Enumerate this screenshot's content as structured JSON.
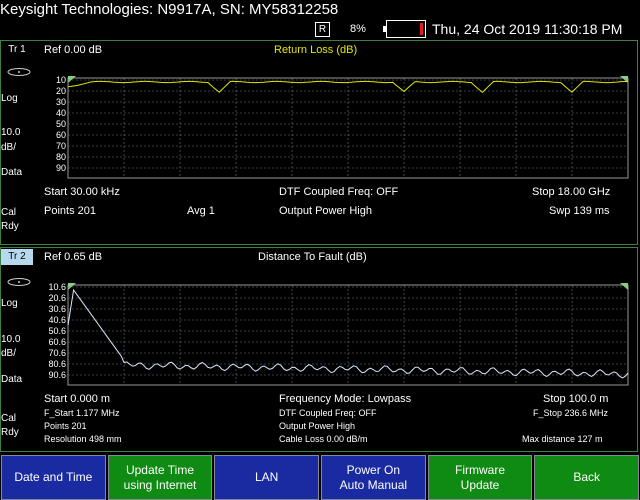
{
  "header": {
    "title": "Keysight Technologies: N9917A, SN: MY58312258",
    "r_indicator": "R",
    "battery_pct": "8%",
    "datetime": "Thu, 24 Oct 2019 11:30:18 PM"
  },
  "trace1": {
    "tab": "Tr 1",
    "ref": "Ref 0.00 dB",
    "name": "Return Loss (dB)",
    "scale_type": "Log",
    "scale_value": "10.0",
    "scale_unit": "dB/",
    "data_label": "Data",
    "cal_label": "Cal",
    "rdy_label": "Rdy",
    "y_ticks": [
      "10",
      "20",
      "30",
      "40",
      "50",
      "60",
      "70",
      "80",
      "90"
    ],
    "start": "Start 30.00 kHz",
    "center": "DTF Coupled Freq: OFF",
    "stop": "Stop 18.00 GHz",
    "points": "Points 201",
    "avg": "Avg  1",
    "output_power": "Output Power High",
    "sweep": "Swp 139 ms",
    "trace_color": "#e6e600"
  },
  "trace2": {
    "tab": "Tr 2",
    "ref": "Ref 0.65 dB",
    "name": "Distance To Fault (dB)",
    "scale_type": "Log",
    "scale_value": "10.0",
    "scale_unit": "dB/",
    "data_label": "Data",
    "cal_label": "Cal",
    "rdy_label": "Rdy",
    "y_ticks": [
      "10.6",
      "20.6",
      "30.6",
      "40.6",
      "50.6",
      "60.6",
      "70.6",
      "80.6",
      "90.6"
    ],
    "start": "Start 0.000 m",
    "center": "Frequency Mode: Lowpass",
    "stop": "Stop 100.0 m",
    "f_start": "F_Start 1.177 MHz",
    "points": "Points 201",
    "resolution": "Resolution 498 mm",
    "dtf_coupled": "DTF Coupled Freq:  OFF",
    "output_power": "Output Power High",
    "cable_loss": "Cable Loss 0.00  dB/m",
    "f_stop": "F_Stop 236.6 MHz",
    "max_distance": "Max distance 127  m",
    "trace_color": "#d8e8ff"
  },
  "softkeys": [
    {
      "label": "Date and Time",
      "label2": "",
      "color": "blue"
    },
    {
      "label": "Update Time",
      "label2": "using Internet",
      "color": "green"
    },
    {
      "label": "LAN",
      "label2": "",
      "color": "blue"
    },
    {
      "label": "Power On",
      "label2": "Auto Manual",
      "color": "blue"
    },
    {
      "label": "Firmware",
      "label2": "Update",
      "color": "green"
    },
    {
      "label": "Back",
      "label2": "",
      "color": "green"
    }
  ]
}
